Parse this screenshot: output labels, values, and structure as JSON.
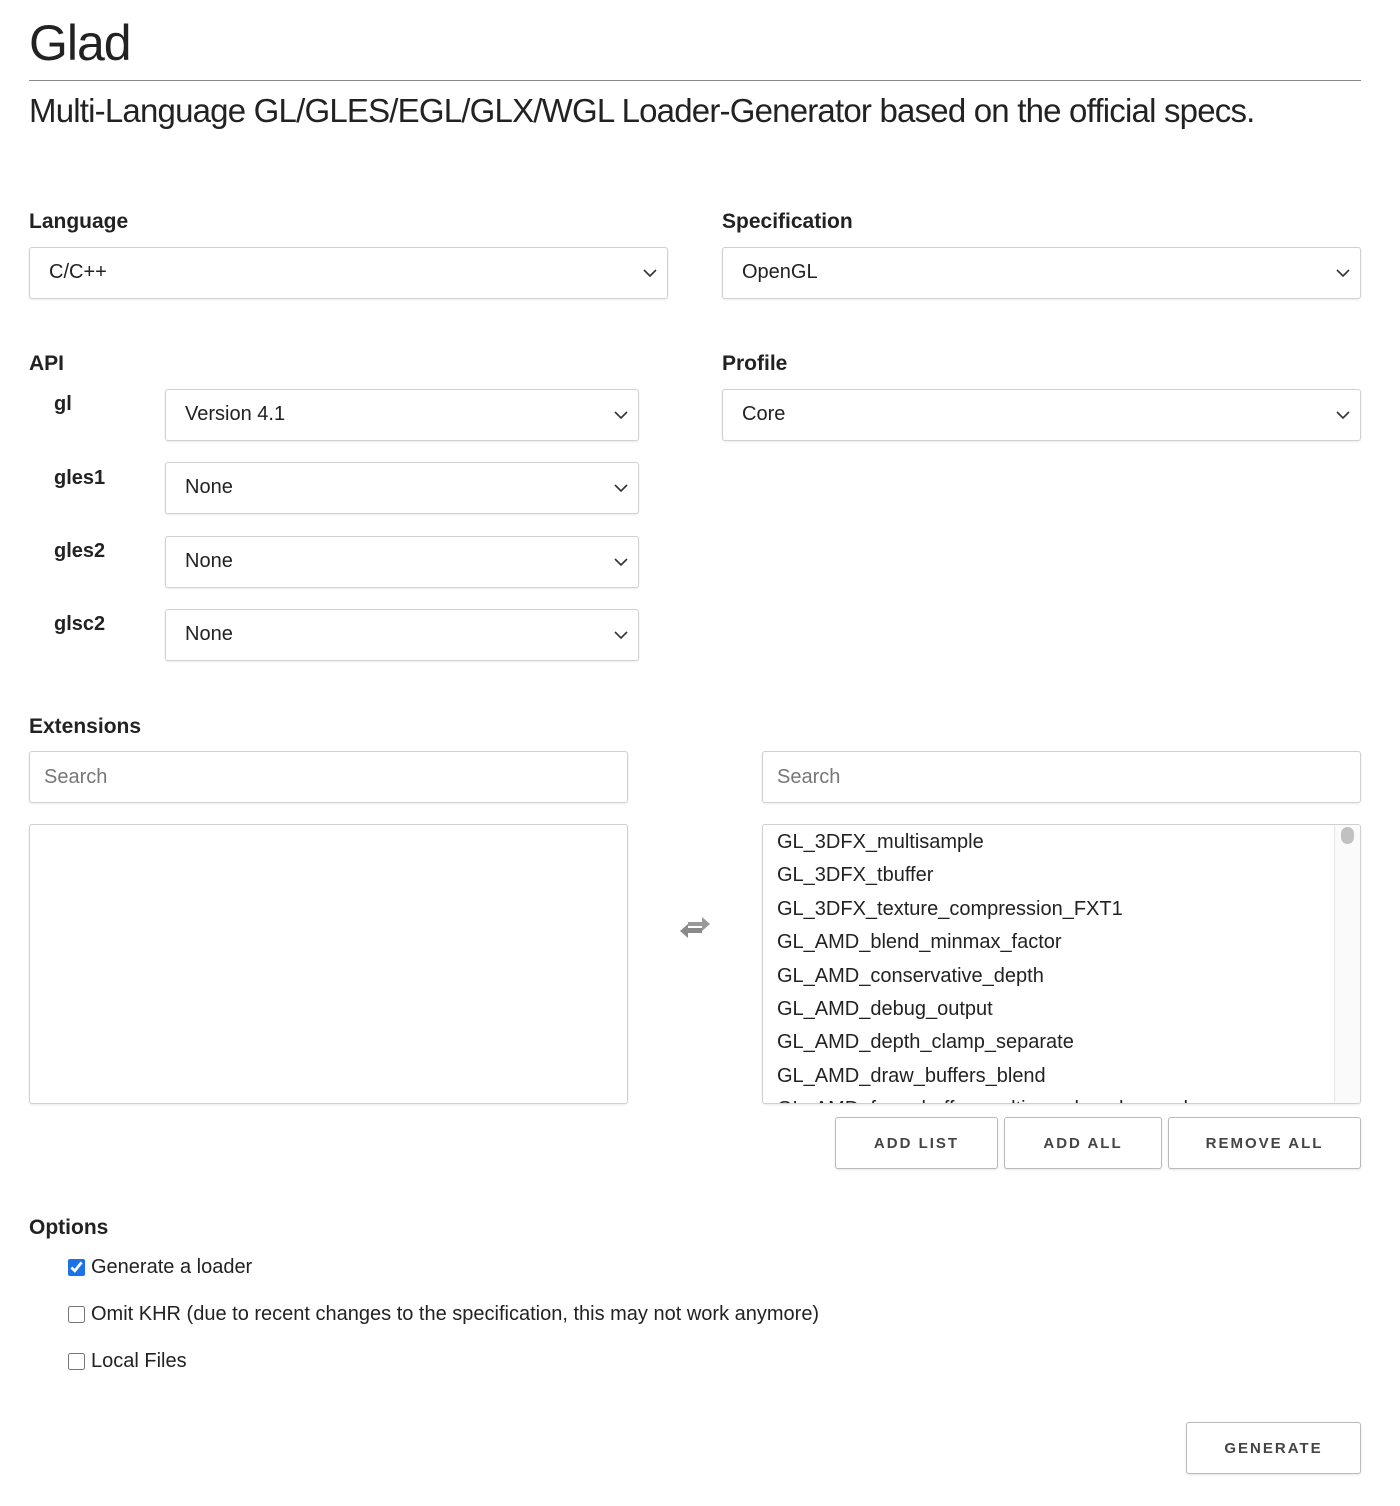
{
  "header": {
    "title": "Glad",
    "subtitle": "Multi-Language GL/GLES/EGL/GLX/WGL Loader-Generator based on the official specs."
  },
  "language": {
    "label": "Language",
    "value": "C/C++"
  },
  "specification": {
    "label": "Specification",
    "value": "OpenGL"
  },
  "api": {
    "label": "API",
    "rows": [
      {
        "name": "gl",
        "value": "Version 4.1"
      },
      {
        "name": "gles1",
        "value": "None"
      },
      {
        "name": "gles2",
        "value": "None"
      },
      {
        "name": "glsc2",
        "value": "None"
      }
    ]
  },
  "profile": {
    "label": "Profile",
    "value": "Core"
  },
  "extensions": {
    "label": "Extensions",
    "selected_search_placeholder": "Search",
    "available_search_placeholder": "Search",
    "swap_icon": "exchange-arrows-icon",
    "available": [
      "GL_3DFX_multisample",
      "GL_3DFX_tbuffer",
      "GL_3DFX_texture_compression_FXT1",
      "GL_AMD_blend_minmax_factor",
      "GL_AMD_conservative_depth",
      "GL_AMD_debug_output",
      "GL_AMD_depth_clamp_separate",
      "GL_AMD_draw_buffers_blend",
      "GL_AMD_framebuffer_multisample_advanced"
    ],
    "buttons": {
      "add_list": "ADD LIST",
      "add_all": "ADD ALL",
      "remove_all": "REMOVE ALL"
    }
  },
  "options": {
    "label": "Options",
    "items": [
      {
        "label": "Generate a loader",
        "checked": true
      },
      {
        "label": "Omit KHR (due to recent changes to the specification, this may not work anymore)",
        "checked": false
      },
      {
        "label": "Local Files",
        "checked": false
      }
    ]
  },
  "generate_label": "GENERATE",
  "colors": {
    "checkbox_accent": "#1a73e8",
    "border": "#d0d0d0"
  }
}
